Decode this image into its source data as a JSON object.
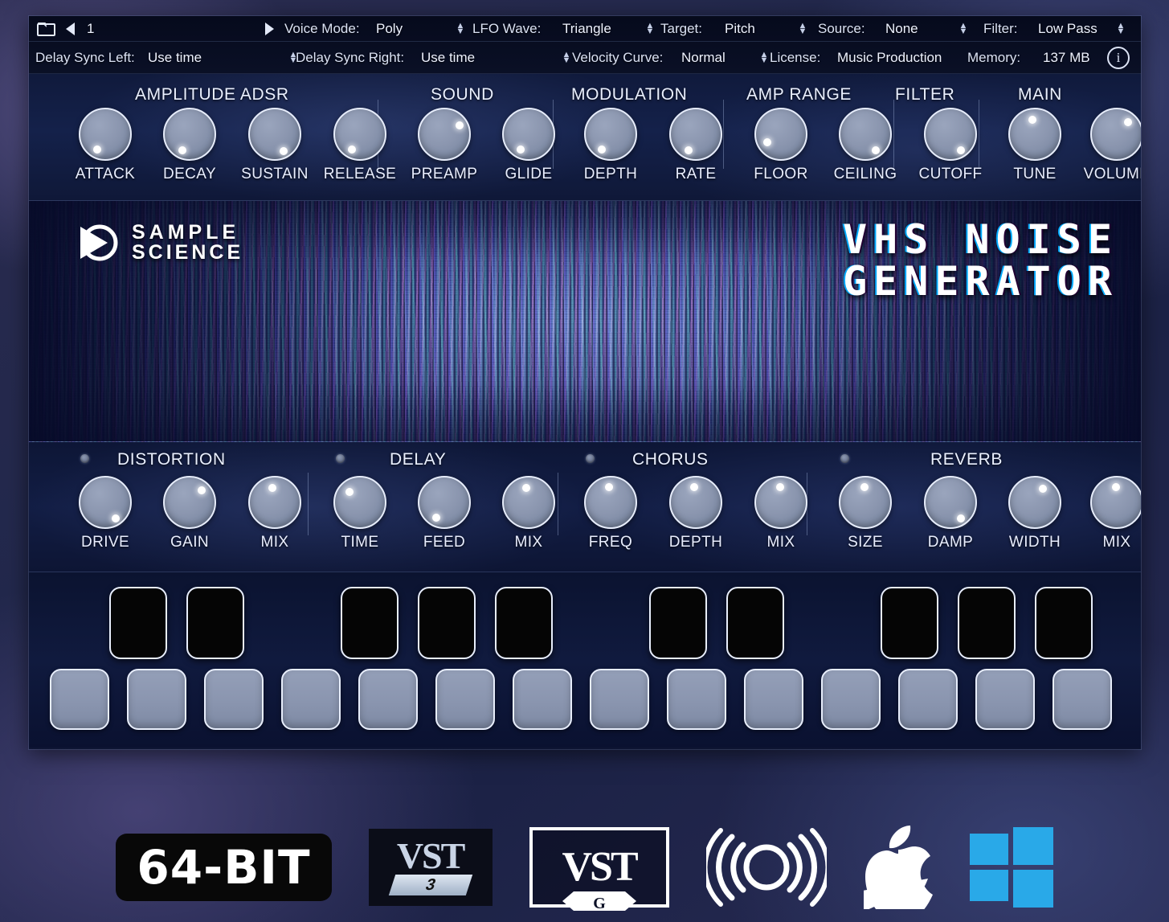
{
  "toolbar": {
    "preset_number": "1",
    "icons": {
      "folder": "folder-icon",
      "prev": "prev-preset",
      "next": "next-preset",
      "info": "i"
    },
    "row1": [
      {
        "label": "Voice Mode:",
        "value": "Poly"
      },
      {
        "label": "LFO Wave:",
        "value": "Triangle"
      },
      {
        "label": "Target:",
        "value": "Pitch"
      },
      {
        "label": "Source:",
        "value": "None"
      },
      {
        "label": "Filter:",
        "value": "Low Pass"
      }
    ],
    "row2": [
      {
        "label": "Delay Sync Left:",
        "value": "Use time"
      },
      {
        "label": "Delay Sync Right:",
        "value": "Use time"
      },
      {
        "label": "Velocity Curve:",
        "value": "Normal"
      },
      {
        "label": "License:",
        "value": "Music Production"
      },
      {
        "label": "Memory:",
        "value": "137 MB"
      }
    ]
  },
  "top_sections": [
    {
      "name": "AMPLITUDE ADSR"
    },
    {
      "name": "SOUND"
    },
    {
      "name": "MODULATION"
    },
    {
      "name": "AMP RANGE"
    },
    {
      "name": "FILTER"
    },
    {
      "name": "MAIN"
    }
  ],
  "top_knobs": [
    {
      "label": "ATTACK",
      "angle": 215
    },
    {
      "label": "DECAY",
      "angle": 212
    },
    {
      "label": "SUSTAIN",
      "angle": 155
    },
    {
      "label": "RELEASE",
      "angle": 215
    },
    {
      "label": "PREAMP",
      "angle": 52
    },
    {
      "label": "GLIDE",
      "angle": 215
    },
    {
      "label": "DEPTH",
      "angle": 218
    },
    {
      "label": "RATE",
      "angle": 212
    },
    {
      "label": "FLOOR",
      "angle": 248
    },
    {
      "label": "CEILING",
      "angle": 150
    },
    {
      "label": "CUTOFF",
      "angle": 150
    },
    {
      "label": "TUNE",
      "angle": 345
    },
    {
      "label": "VOLUME",
      "angle": 35
    }
  ],
  "fx_sections": [
    {
      "name": "DISTORTION",
      "enabled": false
    },
    {
      "name": "DELAY",
      "enabled": false
    },
    {
      "name": "CHORUS",
      "enabled": false
    },
    {
      "name": "REVERB",
      "enabled": false
    }
  ],
  "fx_knobs": [
    {
      "label": "DRIVE",
      "angle": 150
    },
    {
      "label": "GAIN",
      "angle": 38
    },
    {
      "label": "MIX",
      "angle": 345
    },
    {
      "label": "TIME",
      "angle": 315
    },
    {
      "label": "FEED",
      "angle": 215
    },
    {
      "label": "MIX",
      "angle": 345
    },
    {
      "label": "FREQ",
      "angle": 348
    },
    {
      "label": "DEPTH",
      "angle": 350
    },
    {
      "label": "MIX",
      "angle": 352
    },
    {
      "label": "SIZE",
      "angle": 352
    },
    {
      "label": "DAMP",
      "angle": 148
    },
    {
      "label": "WIDTH",
      "angle": 22
    },
    {
      "label": "MIX",
      "angle": 352
    }
  ],
  "keyboard": {
    "white_key_count": 14,
    "black_key_pattern": [
      1,
      2,
      4,
      5,
      6,
      8,
      9,
      11,
      12,
      13
    ]
  },
  "banner": {
    "brand_line1": "SAMPLE",
    "brand_line2": "SCIENCE",
    "title_line1": "VHS NOISE",
    "title_line2": "GENERATOR"
  },
  "footer_badges": [
    {
      "name": "64-bit-badge",
      "text": "64-BIT"
    },
    {
      "name": "vst3-logo",
      "text": "VST",
      "sub": "3"
    },
    {
      "name": "vst-logo",
      "text": "VST"
    },
    {
      "name": "audio-unit-logo",
      "text": ""
    },
    {
      "name": "apple-logo",
      "text": ""
    },
    {
      "name": "windows-logo",
      "text": ""
    }
  ],
  "colors": {
    "panel_bg": "#101a3c",
    "toolbar_bg": "#060a1c",
    "text": "#e9eeff",
    "knob_face": "#8e99b2",
    "knob_ring": "#e6ecfa",
    "windows_blue": "#29a9e8",
    "black_key": "#050505"
  }
}
